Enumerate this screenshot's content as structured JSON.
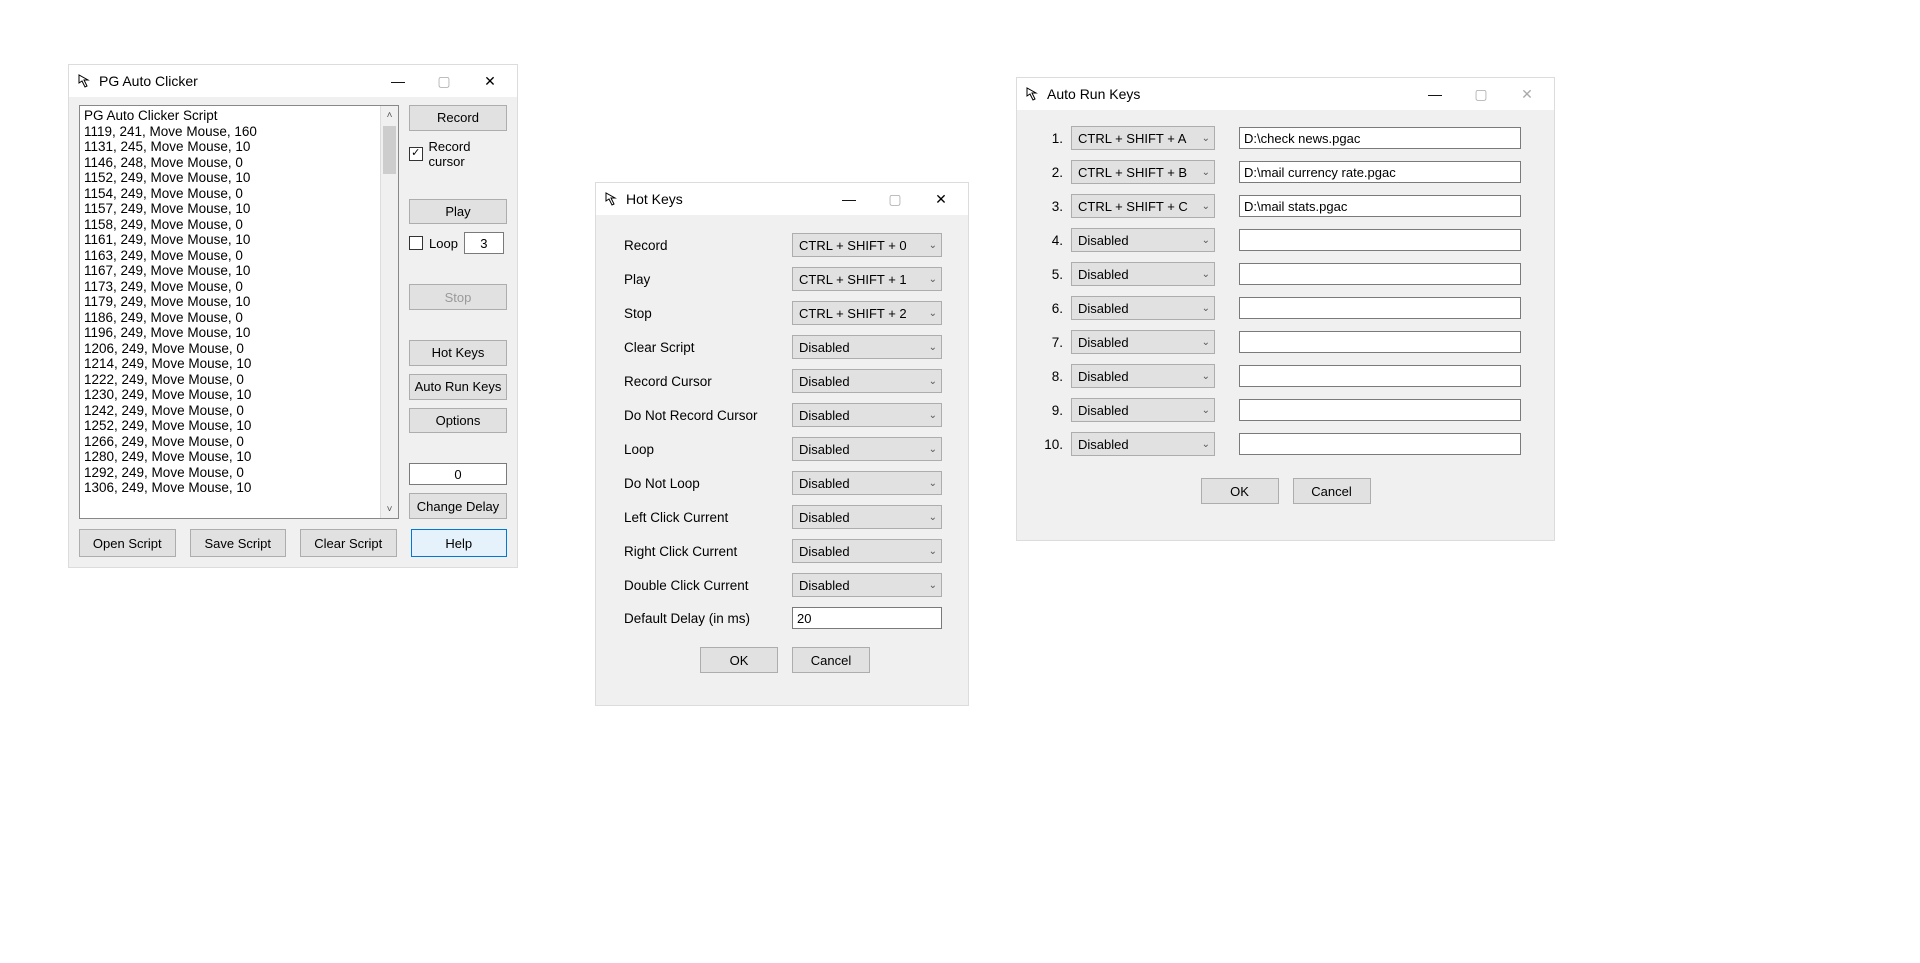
{
  "win1": {
    "title": "PG Auto Clicker",
    "script": [
      "PG Auto Clicker Script",
      "1119, 241, Move Mouse, 160",
      "1131, 245, Move Mouse, 10",
      "1146, 248, Move Mouse, 0",
      "1152, 249, Move Mouse, 10",
      "1154, 249, Move Mouse, 0",
      "1157, 249, Move Mouse, 10",
      "1158, 249, Move Mouse, 0",
      "1161, 249, Move Mouse, 10",
      "1163, 249, Move Mouse, 0",
      "1167, 249, Move Mouse, 10",
      "1173, 249, Move Mouse, 0",
      "1179, 249, Move Mouse, 10",
      "1186, 249, Move Mouse, 0",
      "1196, 249, Move Mouse, 10",
      "1206, 249, Move Mouse, 0",
      "1214, 249, Move Mouse, 10",
      "1222, 249, Move Mouse, 0",
      "1230, 249, Move Mouse, 10",
      "1242, 249, Move Mouse, 0",
      "1252, 249, Move Mouse, 10",
      "1266, 249, Move Mouse, 0",
      "1280, 249, Move Mouse, 10",
      "1292, 249, Move Mouse, 0",
      "1306, 249, Move Mouse, 10"
    ],
    "record": "Record",
    "record_cursor": "Record cursor",
    "record_cursor_checked": true,
    "play": "Play",
    "loop_label": "Loop",
    "loop_checked": false,
    "loop_value": "3",
    "stop": "Stop",
    "hot_keys": "Hot Keys",
    "auto_run_keys": "Auto Run Keys",
    "options": "Options",
    "delay_value": "0",
    "change_delay": "Change Delay",
    "open_script": "Open Script",
    "save_script": "Save Script",
    "clear_script": "Clear Script",
    "help": "Help"
  },
  "win2": {
    "title": "Hot Keys",
    "rows": [
      {
        "label": "Record",
        "value": "CTRL + SHIFT + 0"
      },
      {
        "label": "Play",
        "value": "CTRL + SHIFT + 1"
      },
      {
        "label": "Stop",
        "value": "CTRL + SHIFT + 2"
      },
      {
        "label": "Clear Script",
        "value": "Disabled"
      },
      {
        "label": "Record Cursor",
        "value": "Disabled"
      },
      {
        "label": "Do Not Record Cursor",
        "value": "Disabled"
      },
      {
        "label": "Loop",
        "value": "Disabled"
      },
      {
        "label": "Do Not Loop",
        "value": "Disabled"
      },
      {
        "label": "Left Click Current",
        "value": "Disabled"
      },
      {
        "label": "Right Click Current",
        "value": "Disabled"
      },
      {
        "label": "Double Click Current",
        "value": "Disabled"
      }
    ],
    "delay_label": "Default Delay (in ms)",
    "delay_value": "20",
    "ok": "OK",
    "cancel": "Cancel"
  },
  "win3": {
    "title": "Auto Run Keys",
    "rows": [
      {
        "num": "1.",
        "key": "CTRL + SHIFT + A",
        "path": "D:\\check news.pgac"
      },
      {
        "num": "2.",
        "key": "CTRL + SHIFT + B",
        "path": "D:\\mail currency rate.pgac"
      },
      {
        "num": "3.",
        "key": "CTRL + SHIFT + C",
        "path": "D:\\mail stats.pgac"
      },
      {
        "num": "4.",
        "key": "Disabled",
        "path": ""
      },
      {
        "num": "5.",
        "key": "Disabled",
        "path": ""
      },
      {
        "num": "6.",
        "key": "Disabled",
        "path": ""
      },
      {
        "num": "7.",
        "key": "Disabled",
        "path": ""
      },
      {
        "num": "8.",
        "key": "Disabled",
        "path": ""
      },
      {
        "num": "9.",
        "key": "Disabled",
        "path": ""
      },
      {
        "num": "10.",
        "key": "Disabled",
        "path": ""
      }
    ],
    "ok": "OK",
    "cancel": "Cancel"
  }
}
